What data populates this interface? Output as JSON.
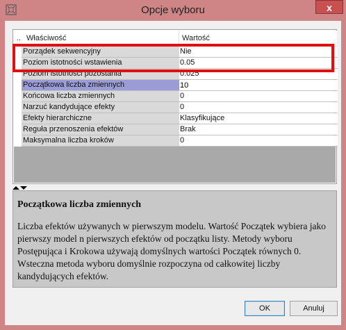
{
  "window": {
    "title": "Opcje wyboru",
    "close_label": "x"
  },
  "grid": {
    "header": {
      "gutter": "..",
      "property": "Właściwość",
      "value": "Wartość"
    },
    "rows": [
      {
        "name": "Porządek sekwencyjny",
        "value": "Nie"
      },
      {
        "name": "Poziom istotności wstawienia",
        "value": "0.05"
      },
      {
        "name": "Poziom istotności pozostania",
        "value": "0.025"
      },
      {
        "name": "Początkowa liczba zmiennych",
        "value": "10"
      },
      {
        "name": "Końcowa liczba zmiennych",
        "value": "0"
      },
      {
        "name": "Narzuć kandydujące efekty",
        "value": "0"
      },
      {
        "name": "Efekty hierarchiczne",
        "value": "Klasyfikujące"
      },
      {
        "name": "Reguła przenoszenia efektów",
        "value": "Brak"
      },
      {
        "name": "Maksymalna liczba kroków",
        "value": "0"
      }
    ]
  },
  "help": {
    "title": "Początkowa liczba zmiennych",
    "text": "Liczba efektów używanych w pierwszym modelu. Wartość Początek wybiera jako pierwszy model n pierwszych efektów od początku listy. Metody wyboru Postępująca i Krokowa używają domyślnych wartości Początek równych 0. Wsteczna metoda wyboru domyślnie rozpoczyna od całkowitej liczby kandydujących efektów."
  },
  "buttons": {
    "ok": "OK",
    "cancel": "Anuluj"
  },
  "colors": {
    "titlebar": "#cf8585",
    "highlight_box": "#e01010",
    "selected_row": "#9b9bd6"
  }
}
